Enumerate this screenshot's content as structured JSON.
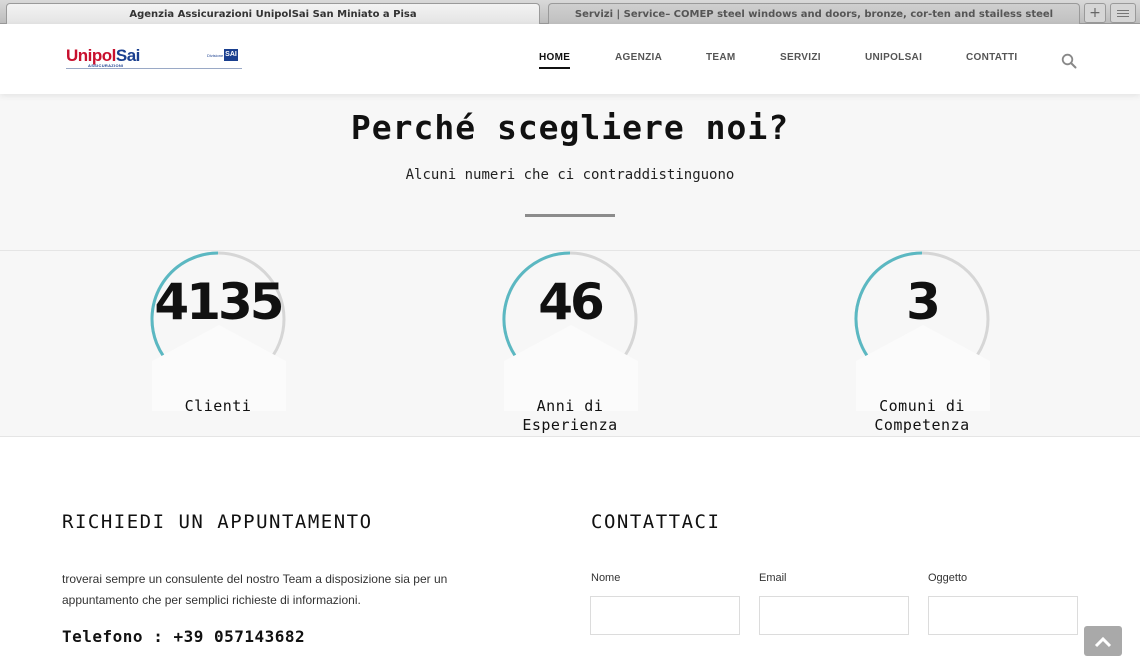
{
  "browser": {
    "tabs": [
      {
        "title": "Agenzia Assicurazioni UnipolSai San Miniato a Pisa",
        "active": true
      },
      {
        "title": "Servizi | Service– COMEP steel windows and doors, bronze, cor-ten and stailess steel",
        "active": false
      }
    ],
    "new_tab_label": "+"
  },
  "header": {
    "logo": {
      "brand_part1": "Unipol",
      "brand_part2": "Sai",
      "tagline": "ASSICURAZIONI",
      "division_label": "Divisione",
      "division_badge": "SAI"
    },
    "nav": [
      "HOME",
      "AGENZIA",
      "TEAM",
      "SERVIZI",
      "UNIPOLSAI",
      "CONTATTI"
    ],
    "active_nav": "HOME",
    "search_icon": "search-icon"
  },
  "why": {
    "title": "Perché scegliere noi?",
    "subtitle": "Alcuni numeri che ci contraddistinguono"
  },
  "counters": [
    {
      "value": "4135",
      "label_lines": [
        "Clienti"
      ],
      "progress": 0.62
    },
    {
      "value": "46",
      "label_lines": [
        "Anni di",
        "Esperienza"
      ],
      "progress": 0.42
    },
    {
      "value": "3",
      "label_lines": [
        "Comuni di",
        "Competenza"
      ],
      "progress": 0.38
    }
  ],
  "colors": {
    "accent_ring": "#5bb8c2",
    "ring_track": "#d6d6d6",
    "section_bg": "#f7f7f7"
  },
  "appointment": {
    "heading": "RICHIEDI UN APPUNTAMENTO",
    "text": "troverai sempre un consulente del nostro Team a disposizione sia per un appuntamento che per semplici richieste di informazioni.",
    "phone": "Telefono : +39 057143682"
  },
  "contact": {
    "heading": "CONTATTACI",
    "fields": [
      {
        "label": "Nome",
        "value": ""
      },
      {
        "label": "Email",
        "value": ""
      },
      {
        "label": "Oggetto",
        "value": ""
      }
    ]
  }
}
